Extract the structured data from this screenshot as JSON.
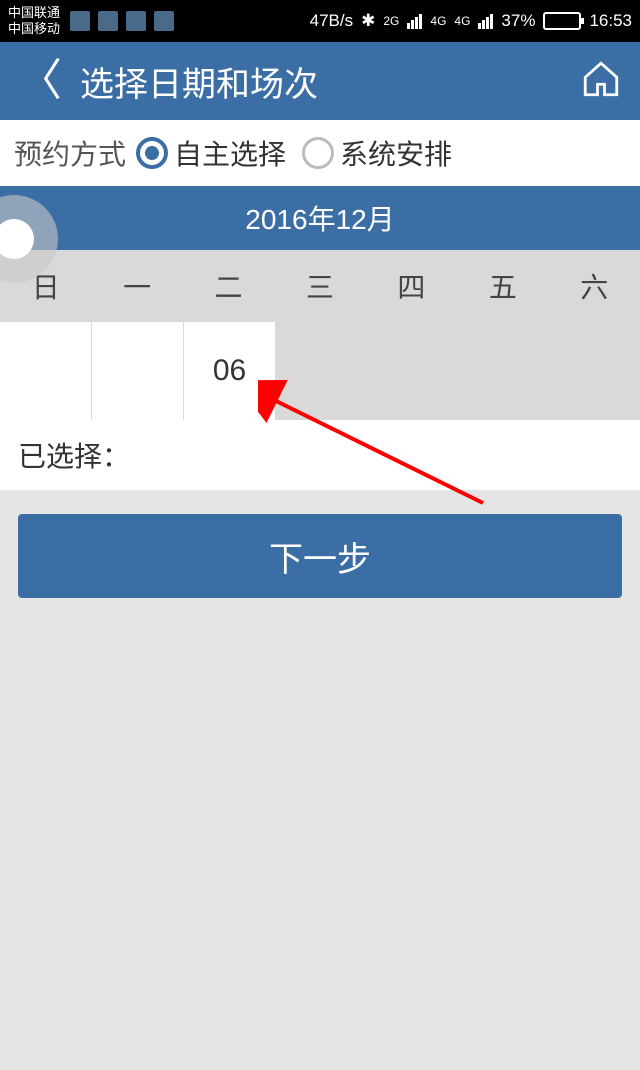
{
  "status": {
    "carrier1": "中国联通",
    "carrier2": "中国移动",
    "speed": "47B/s",
    "net1": "2G",
    "net2": "4G",
    "net3": "4G",
    "battery_pct": "37%",
    "time": "16:53"
  },
  "header": {
    "title": "选择日期和场次"
  },
  "booking": {
    "label": "预约方式",
    "option1": "自主选择",
    "option2": "系统安排"
  },
  "calendar": {
    "month": "2016年12月",
    "weekdays": [
      "日",
      "一",
      "二",
      "三",
      "四",
      "五",
      "六"
    ],
    "visible_date": "06"
  },
  "selected": {
    "label": "已选择："
  },
  "actions": {
    "next": "下一步"
  }
}
